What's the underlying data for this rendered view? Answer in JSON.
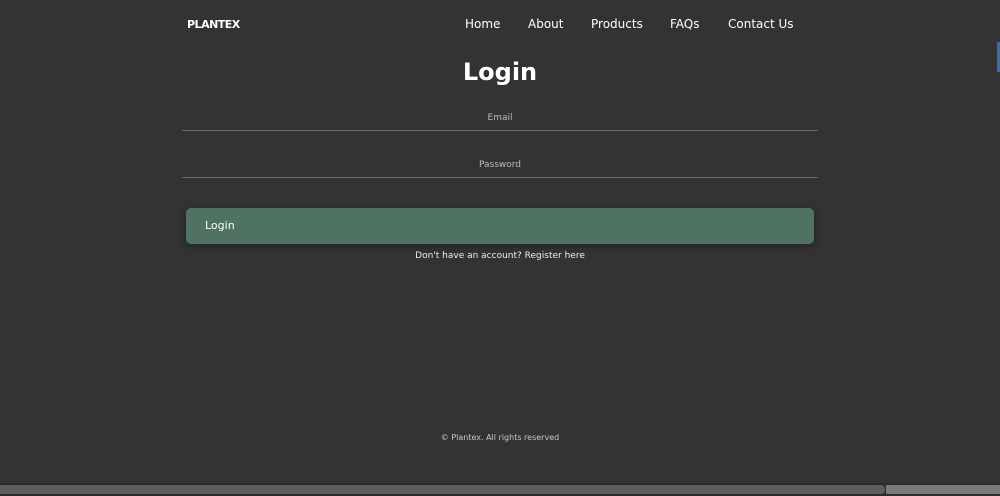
{
  "header": {
    "logo": "PLANTEX",
    "nav": [
      "Home",
      "About",
      "Products",
      "FAQs",
      "Contact Us"
    ]
  },
  "login": {
    "title": "Login",
    "email_placeholder": "Email",
    "password_placeholder": "Password",
    "button": "Login",
    "register": "Don't have an account? Register here"
  },
  "footer": {
    "text": "© Plantex. All rights reserved"
  },
  "colors": {
    "background": "#333334",
    "button": "#4f7262"
  }
}
